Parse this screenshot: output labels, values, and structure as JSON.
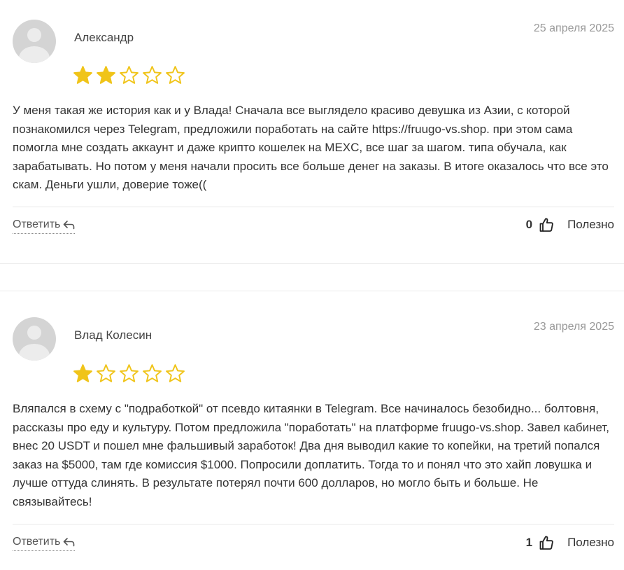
{
  "colors": {
    "star": "#f0c419",
    "muted": "#999999",
    "divider": "#e8e8e8"
  },
  "reviews": [
    {
      "author": "Александр",
      "date": "25 апреля 2025",
      "rating": 2,
      "max_rating": 5,
      "text": "У меня такая же история как и у Влада! Сначала все выглядело красиво девушка из Азии, с которой познакомился через Telegram, предложили поработать на сайте https://fruugo-vs.shop. при этом сама помогла мне создать аккаунт и даже крипто кошелек на MEXC, все шаг за шагом. типа обучала, как зарабатывать. Но потом у меня начали просить все больше денег на заказы. В итоге оказалось что все это скам. Деньги ушли, доверие тоже((",
      "reply_label": "Ответить",
      "helpful_count": "0",
      "helpful_label": "Полезно"
    },
    {
      "author": "Влад Колесин",
      "date": "23 апреля 2025",
      "rating": 1,
      "max_rating": 5,
      "text": "Вляпался в схему с \"подработкой\" от псевдо китаянки в Telegram. Все начиналось безобидно... болтовня, рассказы про еду и культуру. Потом предложила \"поработать\" на платформе fruugo-vs.shop. Завел кабинет, внес 20 USDT и пошел мне фальшивый заработок! Два дня выводил какие то копейки, на третий попался заказ на $5000, там где комиссия $1000. Попросили доплатить. Тогда то и понял что это хайп ловушка и лучше оттуда слинять. В результате потерял почти 600 долларов, но могло быть и больше. Не связывайтесь!",
      "reply_label": "Ответить",
      "helpful_count": "1",
      "helpful_label": "Полезно"
    }
  ]
}
